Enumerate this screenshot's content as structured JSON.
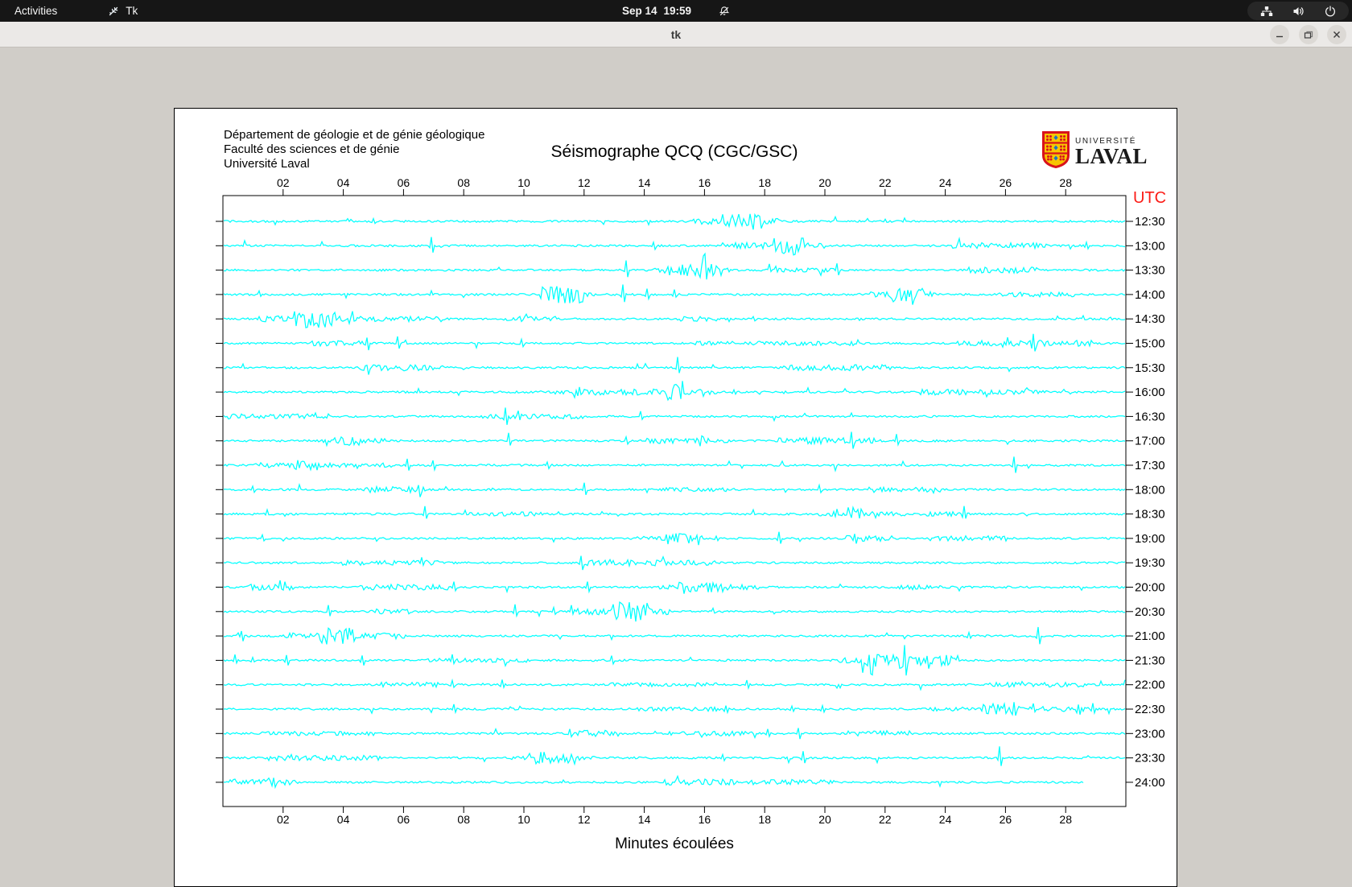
{
  "topbar": {
    "activities_label": "Activities",
    "app_name": "Tk",
    "clock_date": "Sep 14",
    "clock_time": "19:59",
    "icons": [
      "tk-feather-icon",
      "notifications-off-icon",
      "network-icon",
      "volume-icon",
      "power-icon"
    ]
  },
  "window": {
    "title": "tk",
    "controls": [
      "minimize",
      "maximize",
      "close"
    ]
  },
  "seismograph": {
    "institution_lines": [
      "Département de géologie et de génie géologique",
      "Faculté des sciences et de génie",
      "Université Laval"
    ],
    "title": "Séismographe QCQ (CGC/GSC)",
    "logo_top": "UNIVERSITÉ",
    "logo_bottom": "LAVAL",
    "utc_label": "UTC",
    "utc_label_color": "#fb1b16",
    "x_axis_label": "Minutes écoulées",
    "x_tick_labels": [
      "02",
      "04",
      "06",
      "08",
      "10",
      "12",
      "14",
      "16",
      "18",
      "20",
      "22",
      "24",
      "26",
      "28"
    ],
    "x_minutes_range": [
      0,
      30
    ],
    "trace_color": "#00ffff",
    "frame_color": "#000000",
    "last_trace_end_minute": 28.6,
    "traces": [
      {
        "utc": "12:30",
        "spikes": [
          [
            5.0,
            3
          ],
          [
            22.0,
            3
          ]
        ]
      },
      {
        "utc": "13:00",
        "spikes": [
          [
            6.9,
            12
          ],
          [
            14.3,
            5
          ],
          [
            25.7,
            4
          ],
          [
            28.7,
            4
          ]
        ]
      },
      {
        "utc": "13:30",
        "spikes": [
          [
            13.4,
            11
          ],
          [
            14.8,
            6
          ],
          [
            20.4,
            9
          ]
        ]
      },
      {
        "utc": "14:00",
        "spikes": [
          [
            1.2,
            4
          ],
          [
            6.9,
            4
          ],
          [
            13.3,
            12
          ],
          [
            14.1,
            7
          ],
          [
            15.0,
            5
          ]
        ]
      },
      {
        "utc": "14:30",
        "spikes": [
          [
            17.6,
            4
          ],
          [
            28.6,
            3
          ]
        ]
      },
      {
        "utc": "15:00",
        "spikes": [
          [
            4.8,
            10
          ],
          [
            5.8,
            8
          ],
          [
            9.9,
            4
          ],
          [
            26.9,
            13
          ]
        ]
      },
      {
        "utc": "15:30",
        "spikes": [
          [
            15.1,
            10
          ]
        ]
      },
      {
        "utc": "16:00",
        "spikes": [
          [
            17.0,
            3
          ]
        ]
      },
      {
        "utc": "16:30",
        "spikes": [
          [
            3.1,
            6
          ],
          [
            9.4,
            10
          ],
          [
            9.8,
            7
          ],
          [
            13.9,
            6
          ]
        ]
      },
      {
        "utc": "17:00",
        "spikes": [
          [
            9.5,
            9
          ],
          [
            13.4,
            6
          ],
          [
            19.6,
            7
          ],
          [
            20.9,
            8
          ],
          [
            22.4,
            8
          ]
        ]
      },
      {
        "utc": "17:30",
        "spikes": [
          [
            6.1,
            8
          ],
          [
            7.0,
            6
          ],
          [
            10.8,
            5
          ],
          [
            26.3,
            11
          ]
        ]
      },
      {
        "utc": "18:00",
        "spikes": [
          [
            1.0,
            5
          ],
          [
            6.5,
            4
          ],
          [
            12.0,
            8
          ],
          [
            19.8,
            5
          ]
        ]
      },
      {
        "utc": "18:30",
        "spikes": [
          [
            6.7,
            9
          ],
          [
            20.4,
            6
          ],
          [
            24.6,
            8
          ]
        ]
      },
      {
        "utc": "19:00",
        "spikes": [
          [
            1.3,
            5
          ],
          [
            16.4,
            4
          ],
          [
            18.5,
            8
          ],
          [
            21.0,
            9
          ]
        ]
      },
      {
        "utc": "19:30",
        "spikes": [
          [
            6.6,
            8
          ],
          [
            11.9,
            7
          ]
        ]
      },
      {
        "utc": "20:00",
        "spikes": [
          [
            1.9,
            6
          ],
          [
            7.7,
            6
          ],
          [
            12.1,
            8
          ],
          [
            15.6,
            4
          ],
          [
            16.4,
            7
          ]
        ]
      },
      {
        "utc": "20:30",
        "spikes": [
          [
            3.5,
            7
          ],
          [
            9.7,
            8
          ],
          [
            11.0,
            5
          ],
          [
            11.6,
            4
          ],
          [
            14.1,
            5
          ],
          [
            16.3,
            4
          ]
        ]
      },
      {
        "utc": "21:00",
        "spikes": [
          [
            0.6,
            7
          ],
          [
            24.8,
            5
          ],
          [
            27.1,
            12
          ]
        ]
      },
      {
        "utc": "21:30",
        "spikes": [
          [
            0.4,
            6
          ],
          [
            1.0,
            4
          ],
          [
            2.1,
            7
          ],
          [
            4.6,
            7
          ],
          [
            7.6,
            5
          ],
          [
            12.9,
            7
          ],
          [
            23.4,
            10
          ]
        ]
      },
      {
        "utc": "22:00",
        "spikes": [
          [
            7.6,
            5
          ],
          [
            9.3,
            6
          ],
          [
            17.4,
            5
          ]
        ]
      },
      {
        "utc": "22:30",
        "spikes": [
          [
            7.7,
            6
          ],
          [
            14.9,
            4
          ],
          [
            16.7,
            6
          ],
          [
            18.9,
            5
          ],
          [
            19.9,
            5
          ],
          [
            26.3,
            10
          ],
          [
            26.9,
            9
          ],
          [
            28.4,
            7
          ],
          [
            28.9,
            6
          ]
        ]
      },
      {
        "utc": "23:00",
        "spikes": [
          [
            11.5,
            5
          ],
          [
            18.1,
            6
          ],
          [
            19.1,
            8
          ]
        ]
      },
      {
        "utc": "23:30",
        "spikes": [
          [
            16.6,
            5
          ],
          [
            19.3,
            8
          ],
          [
            25.8,
            14
          ]
        ]
      },
      {
        "utc": "24:00",
        "spikes": [
          [
            1.7,
            8
          ]
        ]
      }
    ]
  }
}
